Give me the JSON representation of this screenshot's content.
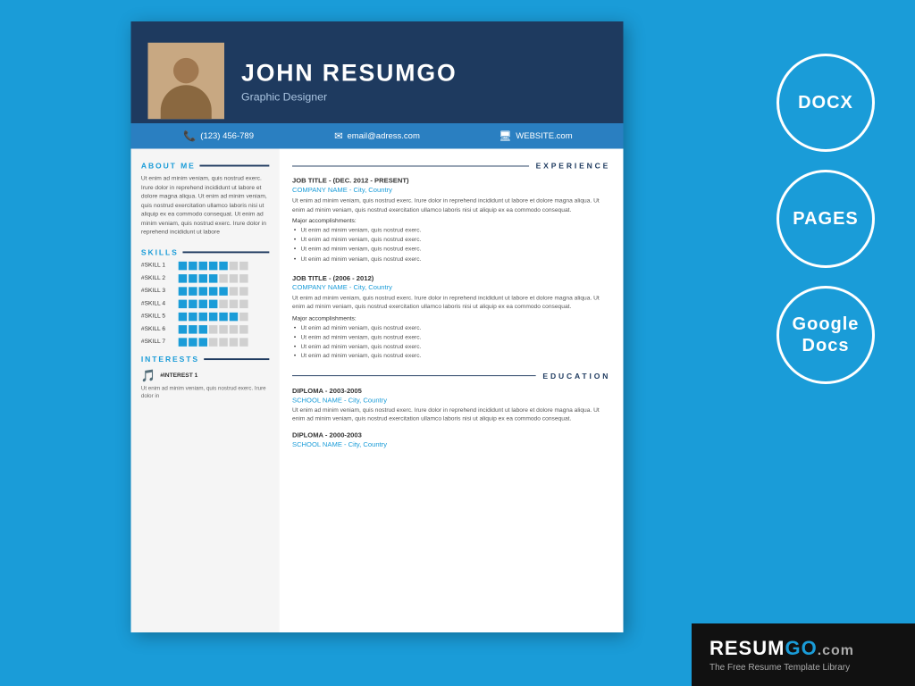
{
  "header": {
    "name": "JOHN RESUMGO",
    "title": "Graphic Designer",
    "phone": "(123) 456-789",
    "email": "email@adress.com",
    "website": "WEBSITE.com"
  },
  "left_column": {
    "about_title": "ABOUT ME",
    "about_text": "Ut enim ad minim veniam, quis nostrud exerc. Irure dolor in reprehend incididunt ut labore et dolore magna aliqua. Ut enim ad minim veniam, quis nostrud exercitation ullamco laboris nisi ut aliquip ex ea commodo consequat. Ut enim ad minim veniam, quis nostrud exerc. Irure dolor in reprehend incididunt ut labore",
    "skills_title": "SKILLS",
    "skills": [
      {
        "label": "#SKILL 1",
        "filled": 5,
        "total": 7
      },
      {
        "label": "#SKILL 2",
        "filled": 4,
        "total": 7
      },
      {
        "label": "#SKILL 3",
        "filled": 5,
        "total": 7
      },
      {
        "label": "#SKILL 4",
        "filled": 4,
        "total": 7
      },
      {
        "label": "#SKILL 5",
        "filled": 6,
        "total": 7
      },
      {
        "label": "#SKILL 6",
        "filled": 3,
        "total": 7
      },
      {
        "label": "#SKILL 7",
        "filled": 3,
        "total": 7
      }
    ],
    "interests_title": "INTERESTS",
    "interests": [
      {
        "name": "#INTEREST 1",
        "desc": "Ut enim ad minim veniam, quis nostrud exerc. Irure dolor in"
      }
    ]
  },
  "right_column": {
    "experience_title": "EXPERIENCE",
    "jobs": [
      {
        "title": "JOB TITLE - (DEC. 2012 - PRESENT)",
        "company": "COMPANY NAME - City, Country",
        "desc": "Ut enim ad minim veniam, quis nostrud exerc. Irure dolor in reprehend incididunt ut labore et dolore magna aliqua. Ut enim ad minim veniam, quis nostrud exercitation ullamco laboris nisi ut aliquip ex ea commodo consequat.",
        "accomplishments_label": "Major accomplishments:",
        "accomplishments": [
          "Ut enim ad minim veniam, quis nostrud exerc.",
          "Ut enim ad minim veniam, quis nostrud exerc.",
          "Ut enim ad minim veniam, quis nostrud exerc.",
          "Ut enim ad minim veniam, quis nostrud exerc."
        ]
      },
      {
        "title": "JOB TITLE - (2006 - 2012)",
        "company": "COMPANY NAME - City, Country",
        "desc": "Ut enim ad minim veniam, quis nostrud exerc. Irure dolor in reprehend incididunt ut labore et dolore magna aliqua. Ut enim ad minim veniam, quis nostrud exercitation ullamco laboris nisi ut aliquip ex ea commodo consequat.",
        "accomplishments_label": "Major accomplishments:",
        "accomplishments": [
          "Ut enim ad minim veniam, quis nostrud exerc.",
          "Ut enim ad minim veniam, quis nostrud exerc.",
          "Ut enim ad minim veniam, quis nostrud exerc.",
          "Ut enim ad minim veniam, quis nostrud exerc."
        ]
      }
    ],
    "education_title": "EDUCATION",
    "diplomas": [
      {
        "title": "DIPLOMA - 2003-2005",
        "school": "SCHOOL NAME - City, Country",
        "desc": "Ut enim ad minim veniam, quis nostrud exerc. Irure dolor in reprehend incididunt ut labore et dolore magna aliqua. Ut enim ad minim veniam, quis nostrud exercitation ullamco laboris nisi ut aliquip ex ea commodo consequat."
      },
      {
        "title": "DIPLOMA - 2000-2003",
        "school": "SCHOOL NAME - City, Country",
        "desc": ""
      }
    ]
  },
  "format_buttons": [
    {
      "label": "DOCX"
    },
    {
      "label": "PAGES"
    },
    {
      "label": "Google\nDocs"
    }
  ],
  "branding": {
    "name_part1": "RESUM",
    "name_go": "GO",
    "name_com": ".com",
    "tagline": "The Free Resume Template Library"
  }
}
